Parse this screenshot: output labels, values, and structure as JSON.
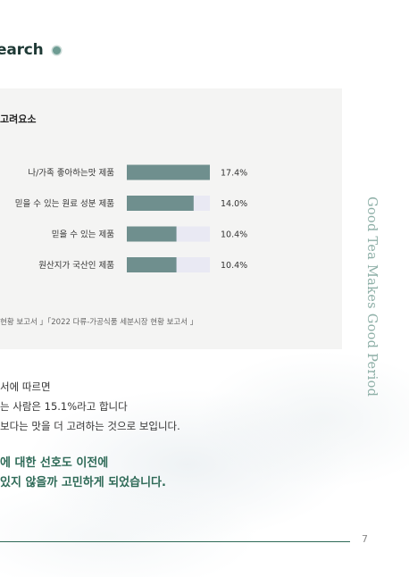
{
  "section": {
    "title": "earch"
  },
  "chart": {
    "title": "고려요소",
    "source": "현황 보고서 」「2022 다류-가공식품 세분시장 현황 보고서 」"
  },
  "chart_data": {
    "type": "bar",
    "orientation": "horizontal",
    "categories": [
      "나/가족 좋아하는맛 제품",
      "믿을 수 있는 원료 성분 제품",
      "믿을 수 있는 제품",
      "원산지가 국산인 제품"
    ],
    "values": [
      17.4,
      14.0,
      10.4,
      10.4
    ],
    "value_labels": [
      "17.4%",
      "14.0%",
      "10.4%",
      "10.4%"
    ],
    "xlim": [
      0,
      20
    ],
    "colors": {
      "bar": "#6f8f8e",
      "track": "#e9e9f3"
    },
    "grid": false,
    "legend": "none"
  },
  "tagline": "Good Tea Makes Good Period",
  "body": {
    "lines": [
      "서에 따르면",
      "는 사람은 15.1%라고 합니다",
      "보다는 맛을 더 고려하는 것으로 보입니다."
    ]
  },
  "emphasis": {
    "lines": [
      "에 대한 선호도 이전에",
      "있지 않을까 고민하게 되었습니다."
    ]
  },
  "footer": {
    "page_number": "7"
  },
  "colors": {
    "accent": "#2e6a57",
    "tagline": "#8fb0a8",
    "card_bg": "#f4f4f3"
  }
}
